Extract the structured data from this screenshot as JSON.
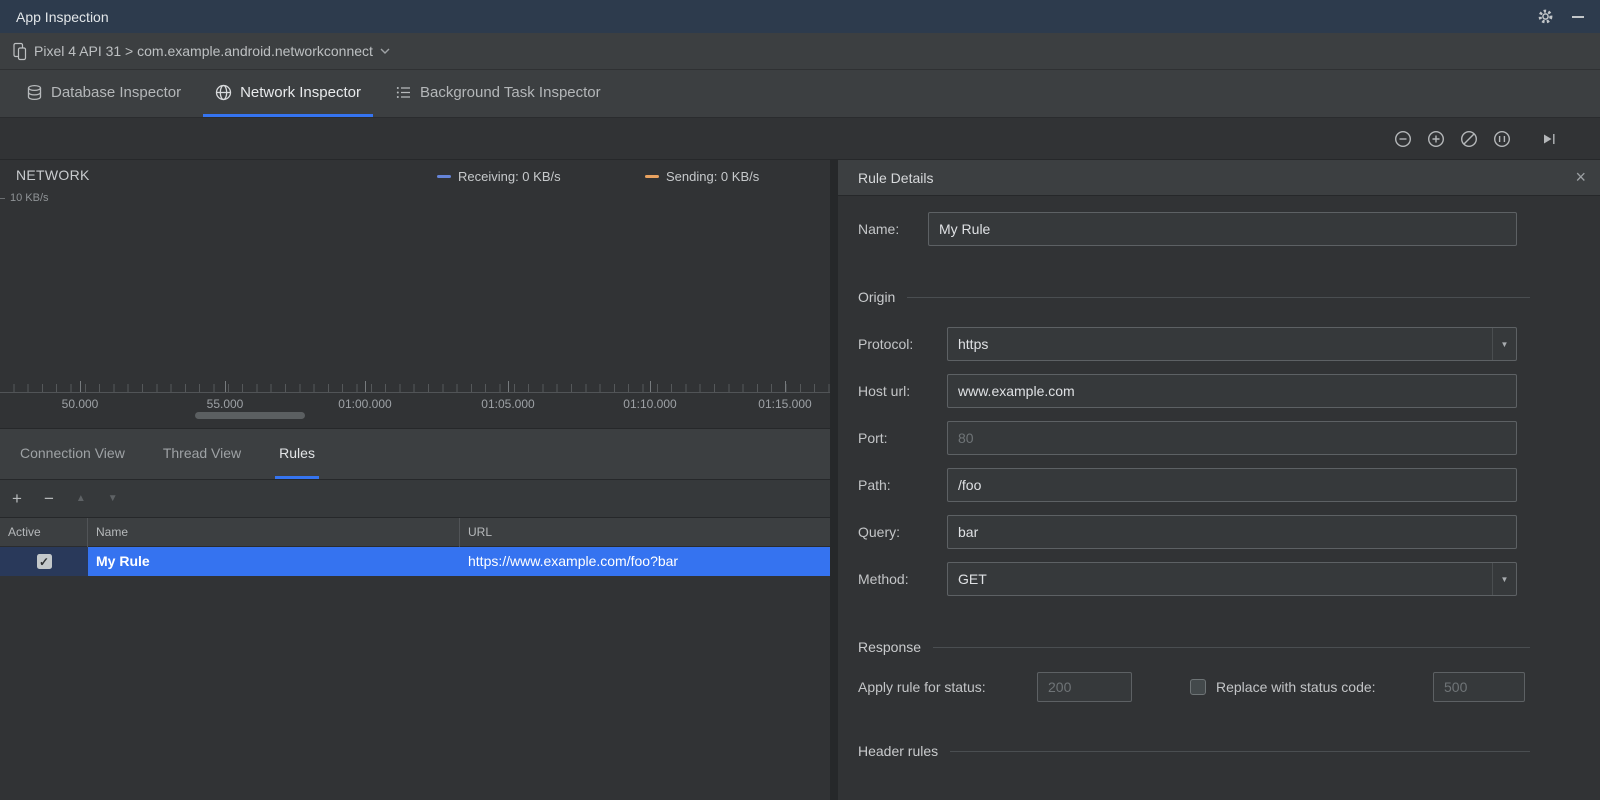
{
  "title_bar": {
    "title": "App Inspection"
  },
  "device_bar": {
    "selector": "Pixel 4 API 31 > com.example.android.networkconnect"
  },
  "main_tabs": {
    "tabs": [
      {
        "label": "Database Inspector"
      },
      {
        "label": "Network Inspector"
      },
      {
        "label": "Background Task Inspector"
      }
    ]
  },
  "chart": {
    "title": "NETWORK",
    "y_axis_top_label": "10 KB/s",
    "legend": [
      {
        "label": "Receiving: 0 KB/s",
        "color": "#6584d8"
      },
      {
        "label": "Sending: 0 KB/s",
        "color": "#e8a260"
      }
    ],
    "x_ticks": [
      "50.000",
      "55.000",
      "01:00.000",
      "01:05.000",
      "01:10.000",
      "01:15.000"
    ]
  },
  "chart_data": {
    "type": "line",
    "title": "NETWORK",
    "x_tick_labels": [
      "50.000",
      "55.000",
      "01:00.000",
      "01:05.000",
      "01:10.000",
      "01:15.000"
    ],
    "y_axis_max_label": "10 KB/s",
    "series": [
      {
        "name": "Receiving",
        "current_rate": "0 KB/s",
        "color": "#6584d8",
        "values": []
      },
      {
        "name": "Sending",
        "current_rate": "0 KB/s",
        "color": "#e8a260",
        "values": []
      }
    ],
    "legend_position": "top"
  },
  "view_tabs": {
    "tabs": [
      {
        "label": "Connection View"
      },
      {
        "label": "Thread View"
      },
      {
        "label": "Rules"
      }
    ]
  },
  "rules_table": {
    "columns": [
      "Active",
      "Name",
      "URL"
    ],
    "row": {
      "active": true,
      "name": "My Rule",
      "url": "https://www.example.com/foo?bar"
    }
  },
  "rule_details": {
    "title": "Rule Details",
    "name_label": "Name:",
    "name_value": "My Rule",
    "origin_section": "Origin",
    "protocol_label": "Protocol:",
    "protocol_value": "https",
    "host_label": "Host url:",
    "host_value": "www.example.com",
    "port_label": "Port:",
    "port_placeholder": "80",
    "path_label": "Path:",
    "path_value": "/foo",
    "query_label": "Query:",
    "query_value": "bar",
    "method_label": "Method:",
    "method_value": "GET",
    "response_section": "Response",
    "status_label": "Apply rule for status:",
    "status_placeholder": "200",
    "replace_label": "Replace with status code:",
    "replace_placeholder": "500",
    "header_rules_section": "Header rules"
  },
  "colors": {
    "selection": "#3573f0",
    "titlebar": "#2d3b4d",
    "accent_underline": "#3574f0"
  }
}
